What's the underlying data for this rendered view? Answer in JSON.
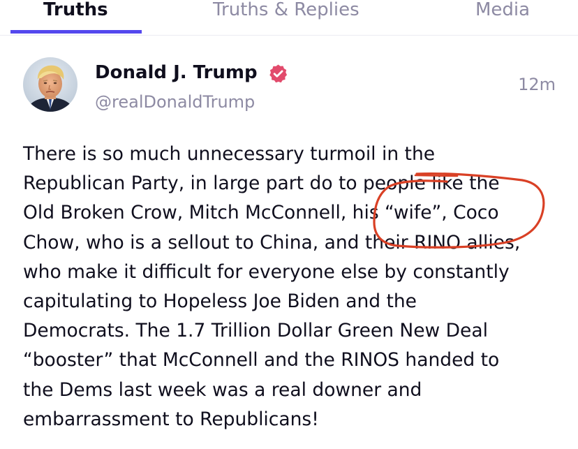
{
  "tabs": [
    {
      "label": "Truths",
      "active": true
    },
    {
      "label": "Truths & Replies",
      "active": false
    },
    {
      "label": "Media",
      "active": false
    }
  ],
  "colors": {
    "accent": "#5448ee",
    "verified": "#e24b6c",
    "annotation": "#d94025",
    "muted": "#8d8aa3"
  },
  "post": {
    "author_name": "Donald J. Trump",
    "author_handle": "@realDonaldTrump",
    "verified_icon": "verified-badge-icon",
    "timestamp": "12m",
    "lines": [
      "There is so much unnecessary turmoil in the",
      "Republican Party, in large part do to people like the",
      "Old Broken Crow, Mitch McConnell, his “wife”, Coco",
      "Chow, who is a sellout to China, and their RINO allies,",
      "who make it difficult for everyone else by constantly",
      "capitulating to Hopeless Joe Biden and the",
      "Democrats. The 1.7 Trillion Dollar Green New Deal",
      "“booster” that McConnell and the RINOS handed to",
      "the Dems last week was a real downer and",
      "embarrassment to Republicans!"
    ]
  }
}
